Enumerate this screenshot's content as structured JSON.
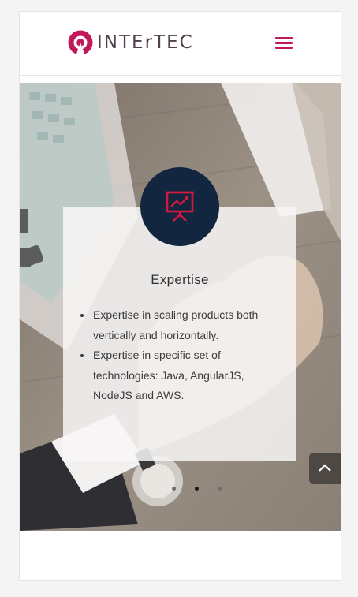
{
  "header": {
    "logo_text": "INTErTEC",
    "menu_icon": "hamburger-icon",
    "brand_color": "#c2185b"
  },
  "slide": {
    "icon": "presentation-chart-icon",
    "title": "Expertise",
    "bullets": [
      "Expertise in scaling products both vertically and horizontally.",
      "Expertise in specific set of technologies: Java, AngularJS, NodeJS and AWS."
    ],
    "circle_color": "#13263f"
  },
  "carousel": {
    "slide_count": 3,
    "active_index": 1
  },
  "scroll_top_icon": "chevron-up-icon"
}
